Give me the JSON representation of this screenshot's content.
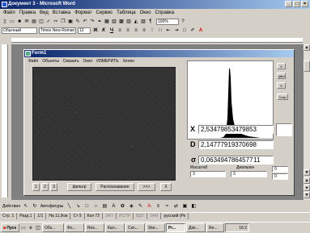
{
  "word": {
    "title": "Документ 3 - Microsoft Word",
    "menu": [
      "Файл",
      "Правка",
      "Вид",
      "Вставка",
      "Формат",
      "Сервис",
      "Таблица",
      "Окно",
      "Справка"
    ],
    "style_combo": "Обычный",
    "font_combo": "Times New Roman",
    "size_combo": "12",
    "zoom_combo": "100%",
    "status": [
      "Стр. 1",
      "Разд 1",
      "1/1",
      "На 11,9см",
      "Ст 9",
      "Кол 72",
      "ЗАП",
      "ИСПР",
      "ВДЛ",
      "ЗАМ",
      "русский (Ро"
    ],
    "drawbar": {
      "actions": "Действия",
      "autoshapes": "Автофигуры"
    }
  },
  "form1": {
    "title": "Form1",
    "menu": [
      "Файл",
      "Объекты",
      "Смазать",
      "Окно",
      "ИЗМЕРИТЬ",
      "Хенон"
    ],
    "side_buttons": [
      "X",
      "Цвет",
      "S",
      "Сохр"
    ],
    "values": {
      "x_label": "X",
      "x_value": "2,53479853479853",
      "d_label": "D",
      "d_value": "2,14777919370698",
      "s_label": "σ",
      "s_value": "0,0634947864577 11"
    },
    "controls": {
      "scale_label": "Масштаб",
      "scale_value": "3",
      "range_label": "Диапазон",
      "range_value": "3",
      "spin_a": "0",
      "spin_b": "0"
    },
    "bottom_buttons": [
      "1",
      "2",
      "3",
      "фильтр",
      "Распознавание",
      ">>>",
      "X"
    ]
  },
  "taskbar": {
    "start": "Пуск",
    "items": [
      "Обз...",
      "Фо...",
      "Res...",
      "Кал...",
      "Ско...",
      "Ske...",
      "Pr...",
      "Док...",
      "Re..."
    ],
    "clock": "16:2"
  },
  "colors": {
    "titlebar": "#0a246a",
    "face": "#d4d0c8"
  }
}
